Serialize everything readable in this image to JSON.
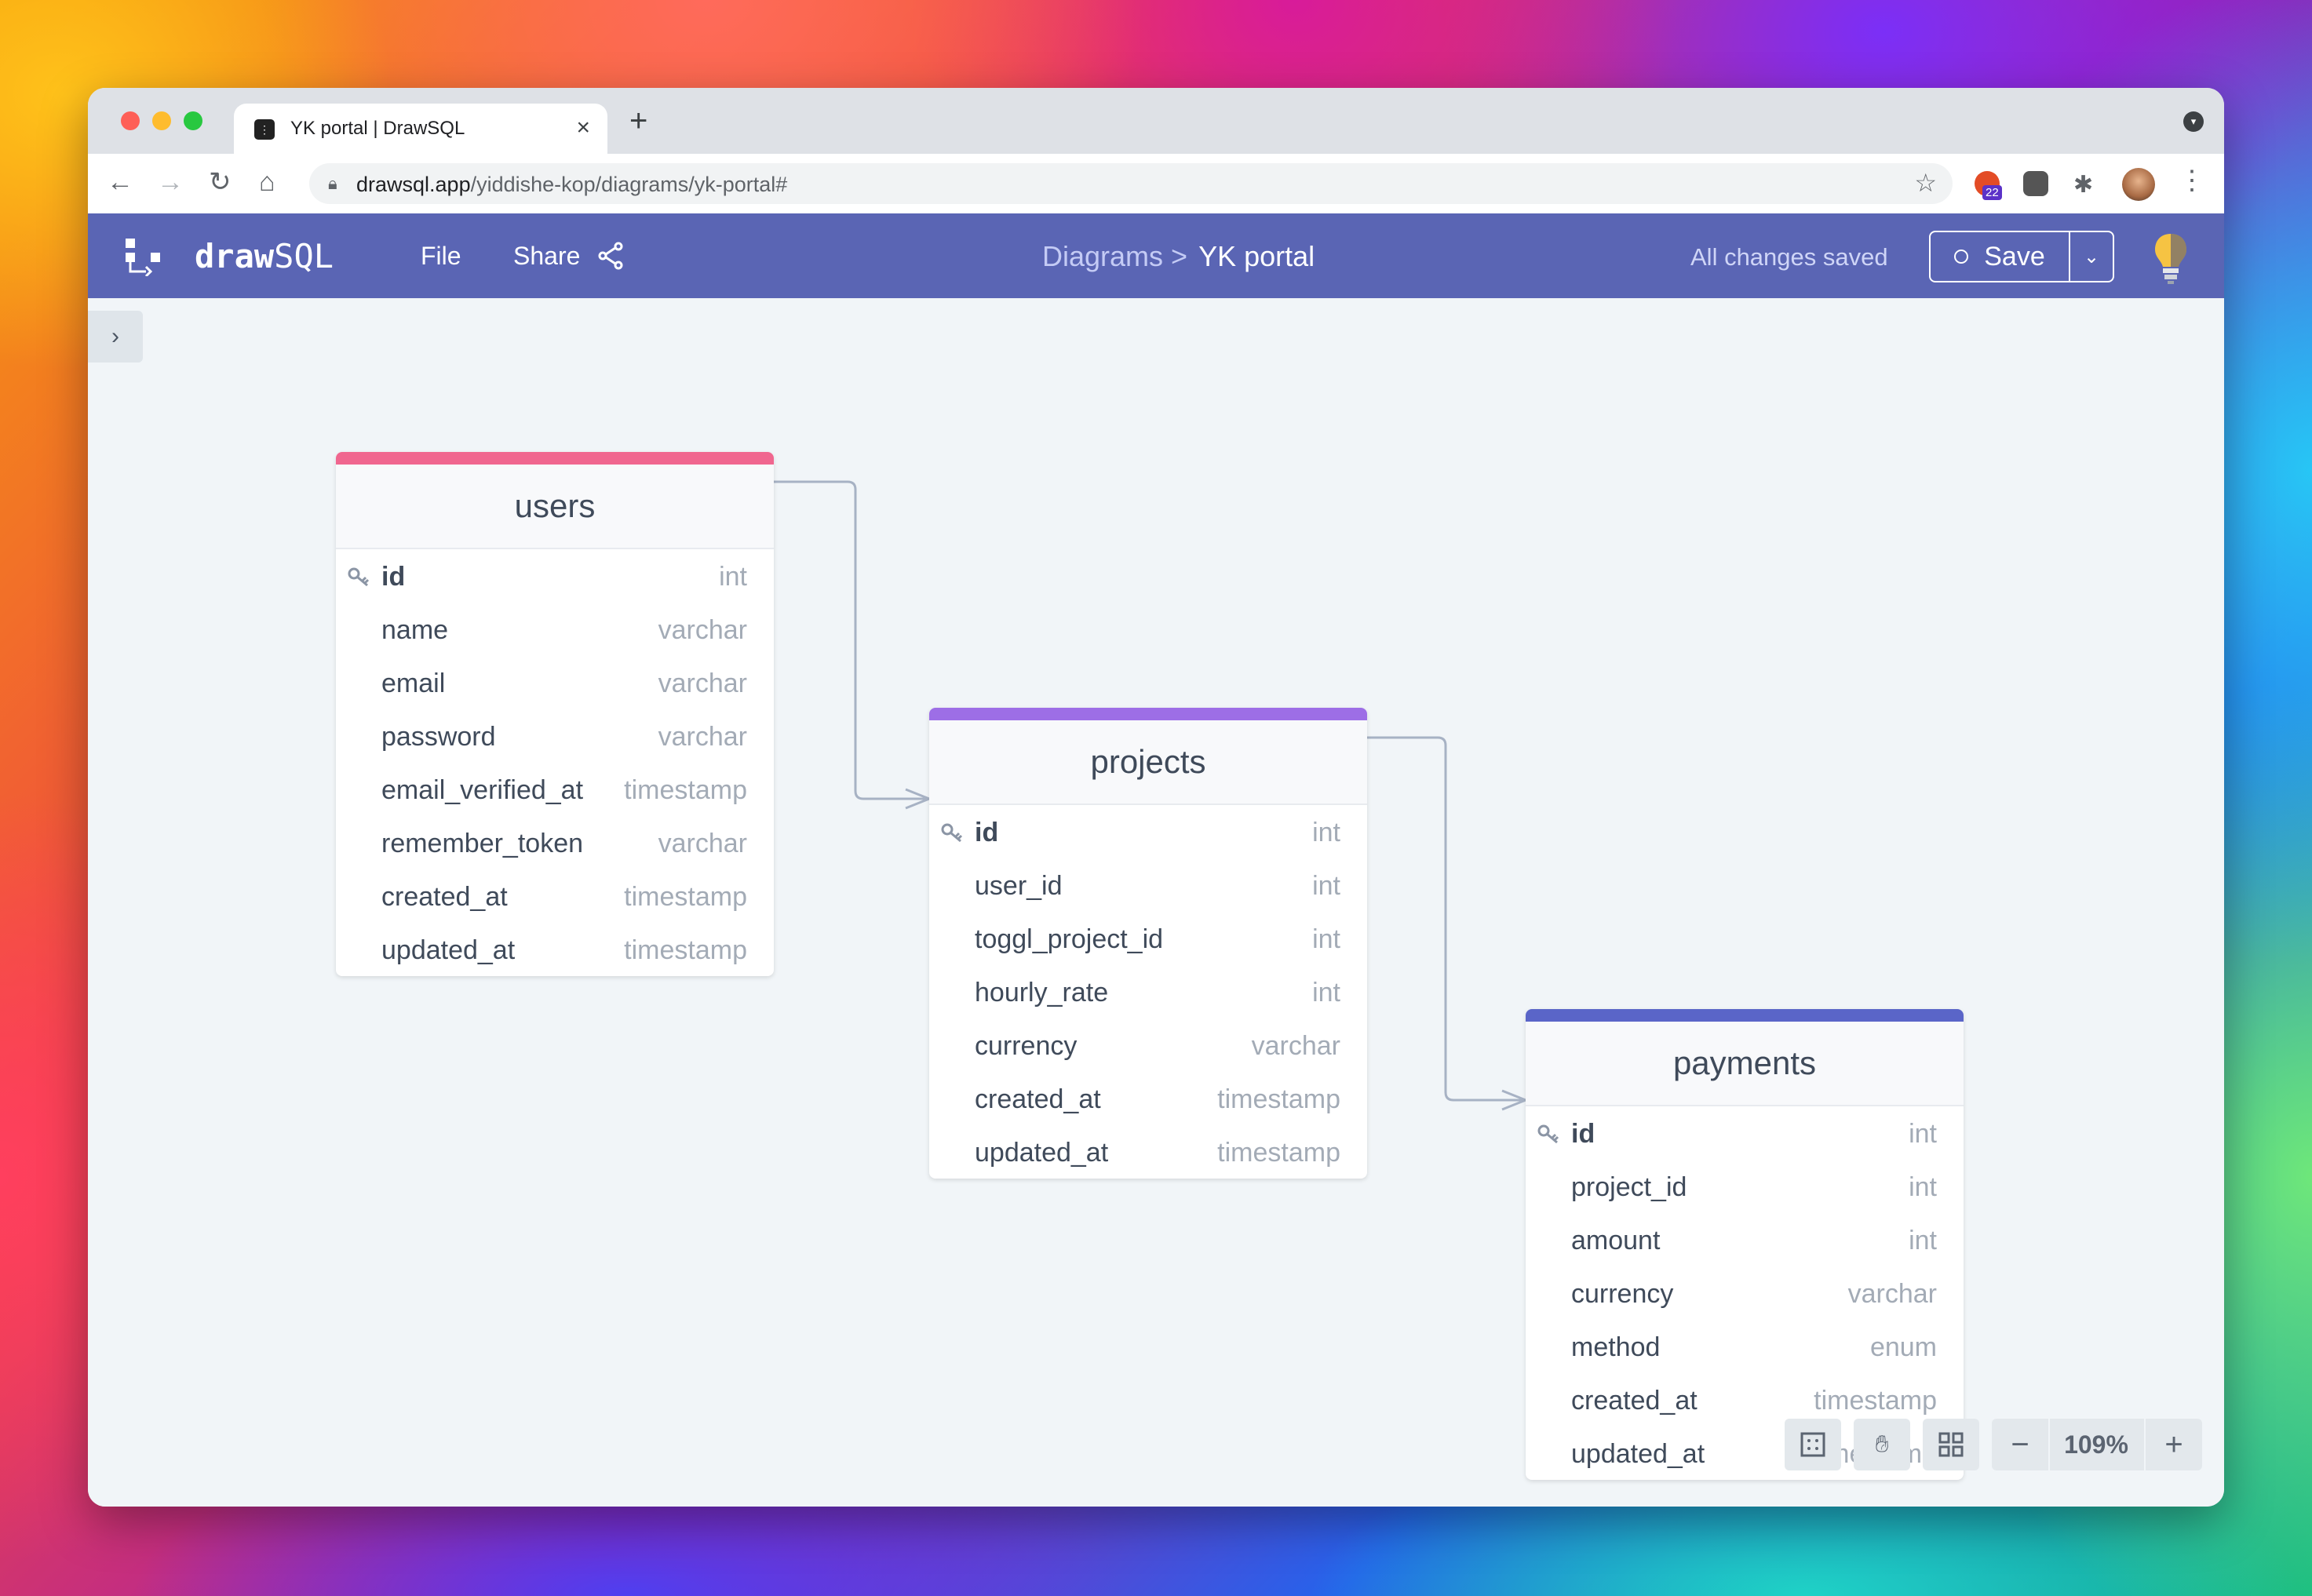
{
  "browser": {
    "tab_title": "YK portal | DrawSQL",
    "url_host": "drawsql.app",
    "url_path": "/yiddishe-kop/diagrams/yk-portal#",
    "extension_badge": "22"
  },
  "app": {
    "logo_bold": "draw",
    "logo_light": "SQL",
    "menu_file": "File",
    "menu_share": "Share",
    "breadcrumb_parent": "Diagrams >",
    "breadcrumb_current": "YK portal",
    "save_status": "All changes saved",
    "save_label": "Save"
  },
  "colors": {
    "header_bg": "#5a65b4",
    "users_accent": "#f0668f",
    "projects_accent": "#9d6ee6",
    "payments_accent": "#5a65c8"
  },
  "tables": {
    "users": {
      "name": "users",
      "columns": [
        {
          "name": "id",
          "type": "int",
          "pk": true
        },
        {
          "name": "name",
          "type": "varchar"
        },
        {
          "name": "email",
          "type": "varchar"
        },
        {
          "name": "password",
          "type": "varchar"
        },
        {
          "name": "email_verified_at",
          "type": "timestamp"
        },
        {
          "name": "remember_token",
          "type": "varchar"
        },
        {
          "name": "created_at",
          "type": "timestamp"
        },
        {
          "name": "updated_at",
          "type": "timestamp"
        }
      ]
    },
    "projects": {
      "name": "projects",
      "columns": [
        {
          "name": "id",
          "type": "int",
          "pk": true
        },
        {
          "name": "user_id",
          "type": "int"
        },
        {
          "name": "toggl_project_id",
          "type": "int"
        },
        {
          "name": "hourly_rate",
          "type": "int"
        },
        {
          "name": "currency",
          "type": "varchar"
        },
        {
          "name": "created_at",
          "type": "timestamp"
        },
        {
          "name": "updated_at",
          "type": "timestamp"
        }
      ]
    },
    "payments": {
      "name": "payments",
      "columns": [
        {
          "name": "id",
          "type": "int",
          "pk": true
        },
        {
          "name": "project_id",
          "type": "int"
        },
        {
          "name": "amount",
          "type": "int"
        },
        {
          "name": "currency",
          "type": "varchar"
        },
        {
          "name": "method",
          "type": "enum"
        },
        {
          "name": "created_at",
          "type": "timestamp"
        },
        {
          "name": "updated_at",
          "type": "timestamp"
        }
      ]
    }
  },
  "zoom": {
    "level": "109%"
  }
}
